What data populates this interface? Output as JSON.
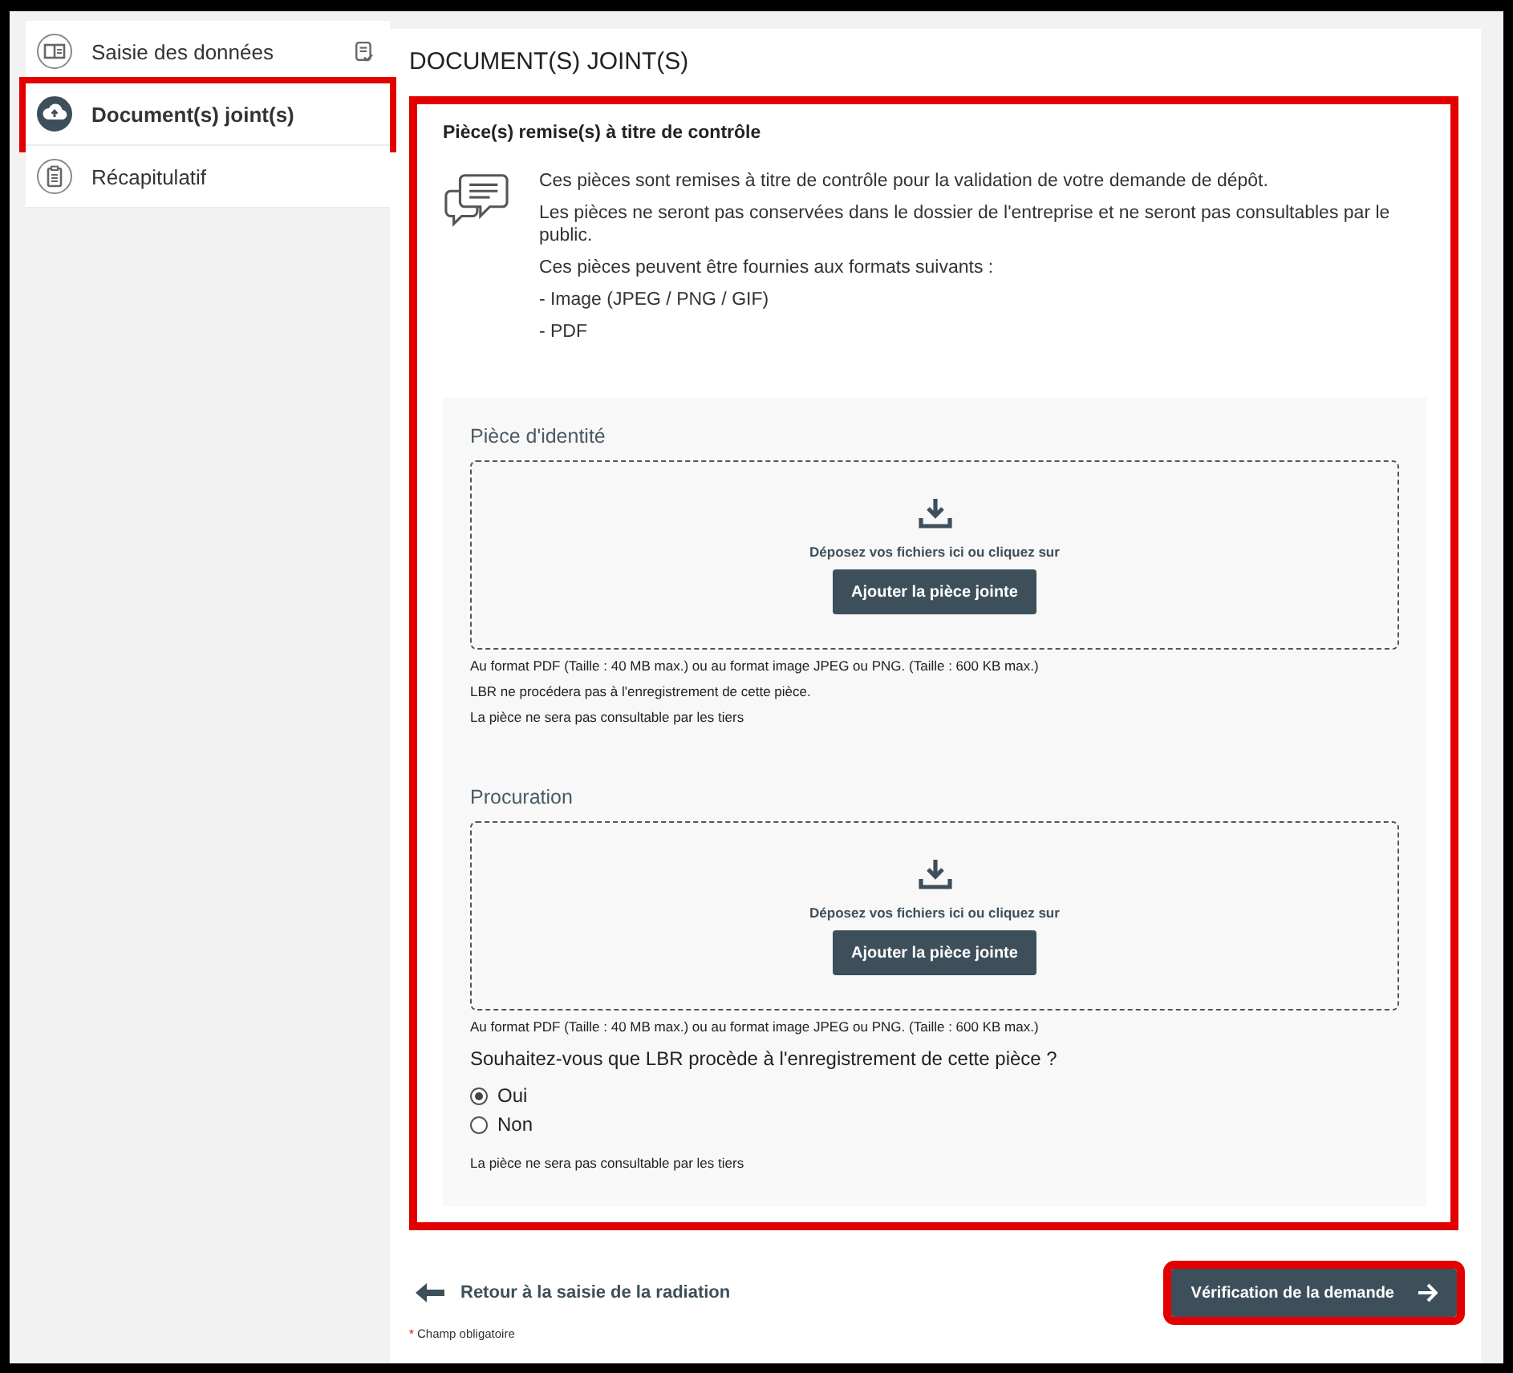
{
  "sidebar": {
    "items": [
      {
        "kind": "data",
        "label": "Saisie des données",
        "selected": false,
        "highlighted": false,
        "completed": true
      },
      {
        "kind": "upload",
        "label": "Document(s) joint(s)",
        "selected": true,
        "highlighted": true,
        "completed": false
      },
      {
        "kind": "summary",
        "label": "Récapitulatif",
        "selected": false,
        "highlighted": false,
        "completed": false
      }
    ]
  },
  "page_title": "DOCUMENT(S) JOINT(S)",
  "section": {
    "title": "Pièce(s) remise(s) à titre de contrôle",
    "highlighted": true,
    "paragraphs": [
      "Ces pièces sont remises à titre de contrôle pour la validation de votre demande de dépôt.",
      "Les pièces ne seront pas conservées dans le dossier de l'entreprise et ne seront pas consultables par le public.",
      "Ces pièces peuvent être fournies aux formats suivants :",
      "- Image (JPEG / PNG / GIF)",
      "- PDF"
    ],
    "uploads": [
      {
        "label": "Pièce d'identité",
        "drop_text": "Déposez vos fichiers ici ou cliquez sur",
        "button": "Ajouter la pièce jointe",
        "format_note": "Au format PDF (Taille : 40 MB max.) ou au format image JPEG ou PNG. (Taille : 600 KB max.)",
        "notes": [
          "LBR ne procédera pas à l'enregistrement de cette pièce.",
          "La pièce ne sera pas consultable par les tiers"
        ]
      },
      {
        "label": "Procuration",
        "drop_text": "Déposez vos fichiers ici ou cliquez sur",
        "button": "Ajouter la pièce jointe",
        "format_note": "Au format PDF (Taille : 40 MB max.) ou au format image JPEG ou PNG. (Taille : 600 KB max.)",
        "question": "Souhaitez-vous que LBR procède à l'enregistrement de cette pièce ?",
        "options": [
          {
            "label": "Oui",
            "selected": true
          },
          {
            "label": "Non",
            "selected": false
          }
        ],
        "notes": [
          "La pièce ne sera pas consultable par les tiers"
        ]
      }
    ]
  },
  "footer": {
    "back_link": "Retour à la saisie de la radiation",
    "next_button": {
      "label": "Vérification de la demande",
      "highlighted": true
    },
    "required_marker": "*",
    "required_note": "Champ obligatoire"
  }
}
